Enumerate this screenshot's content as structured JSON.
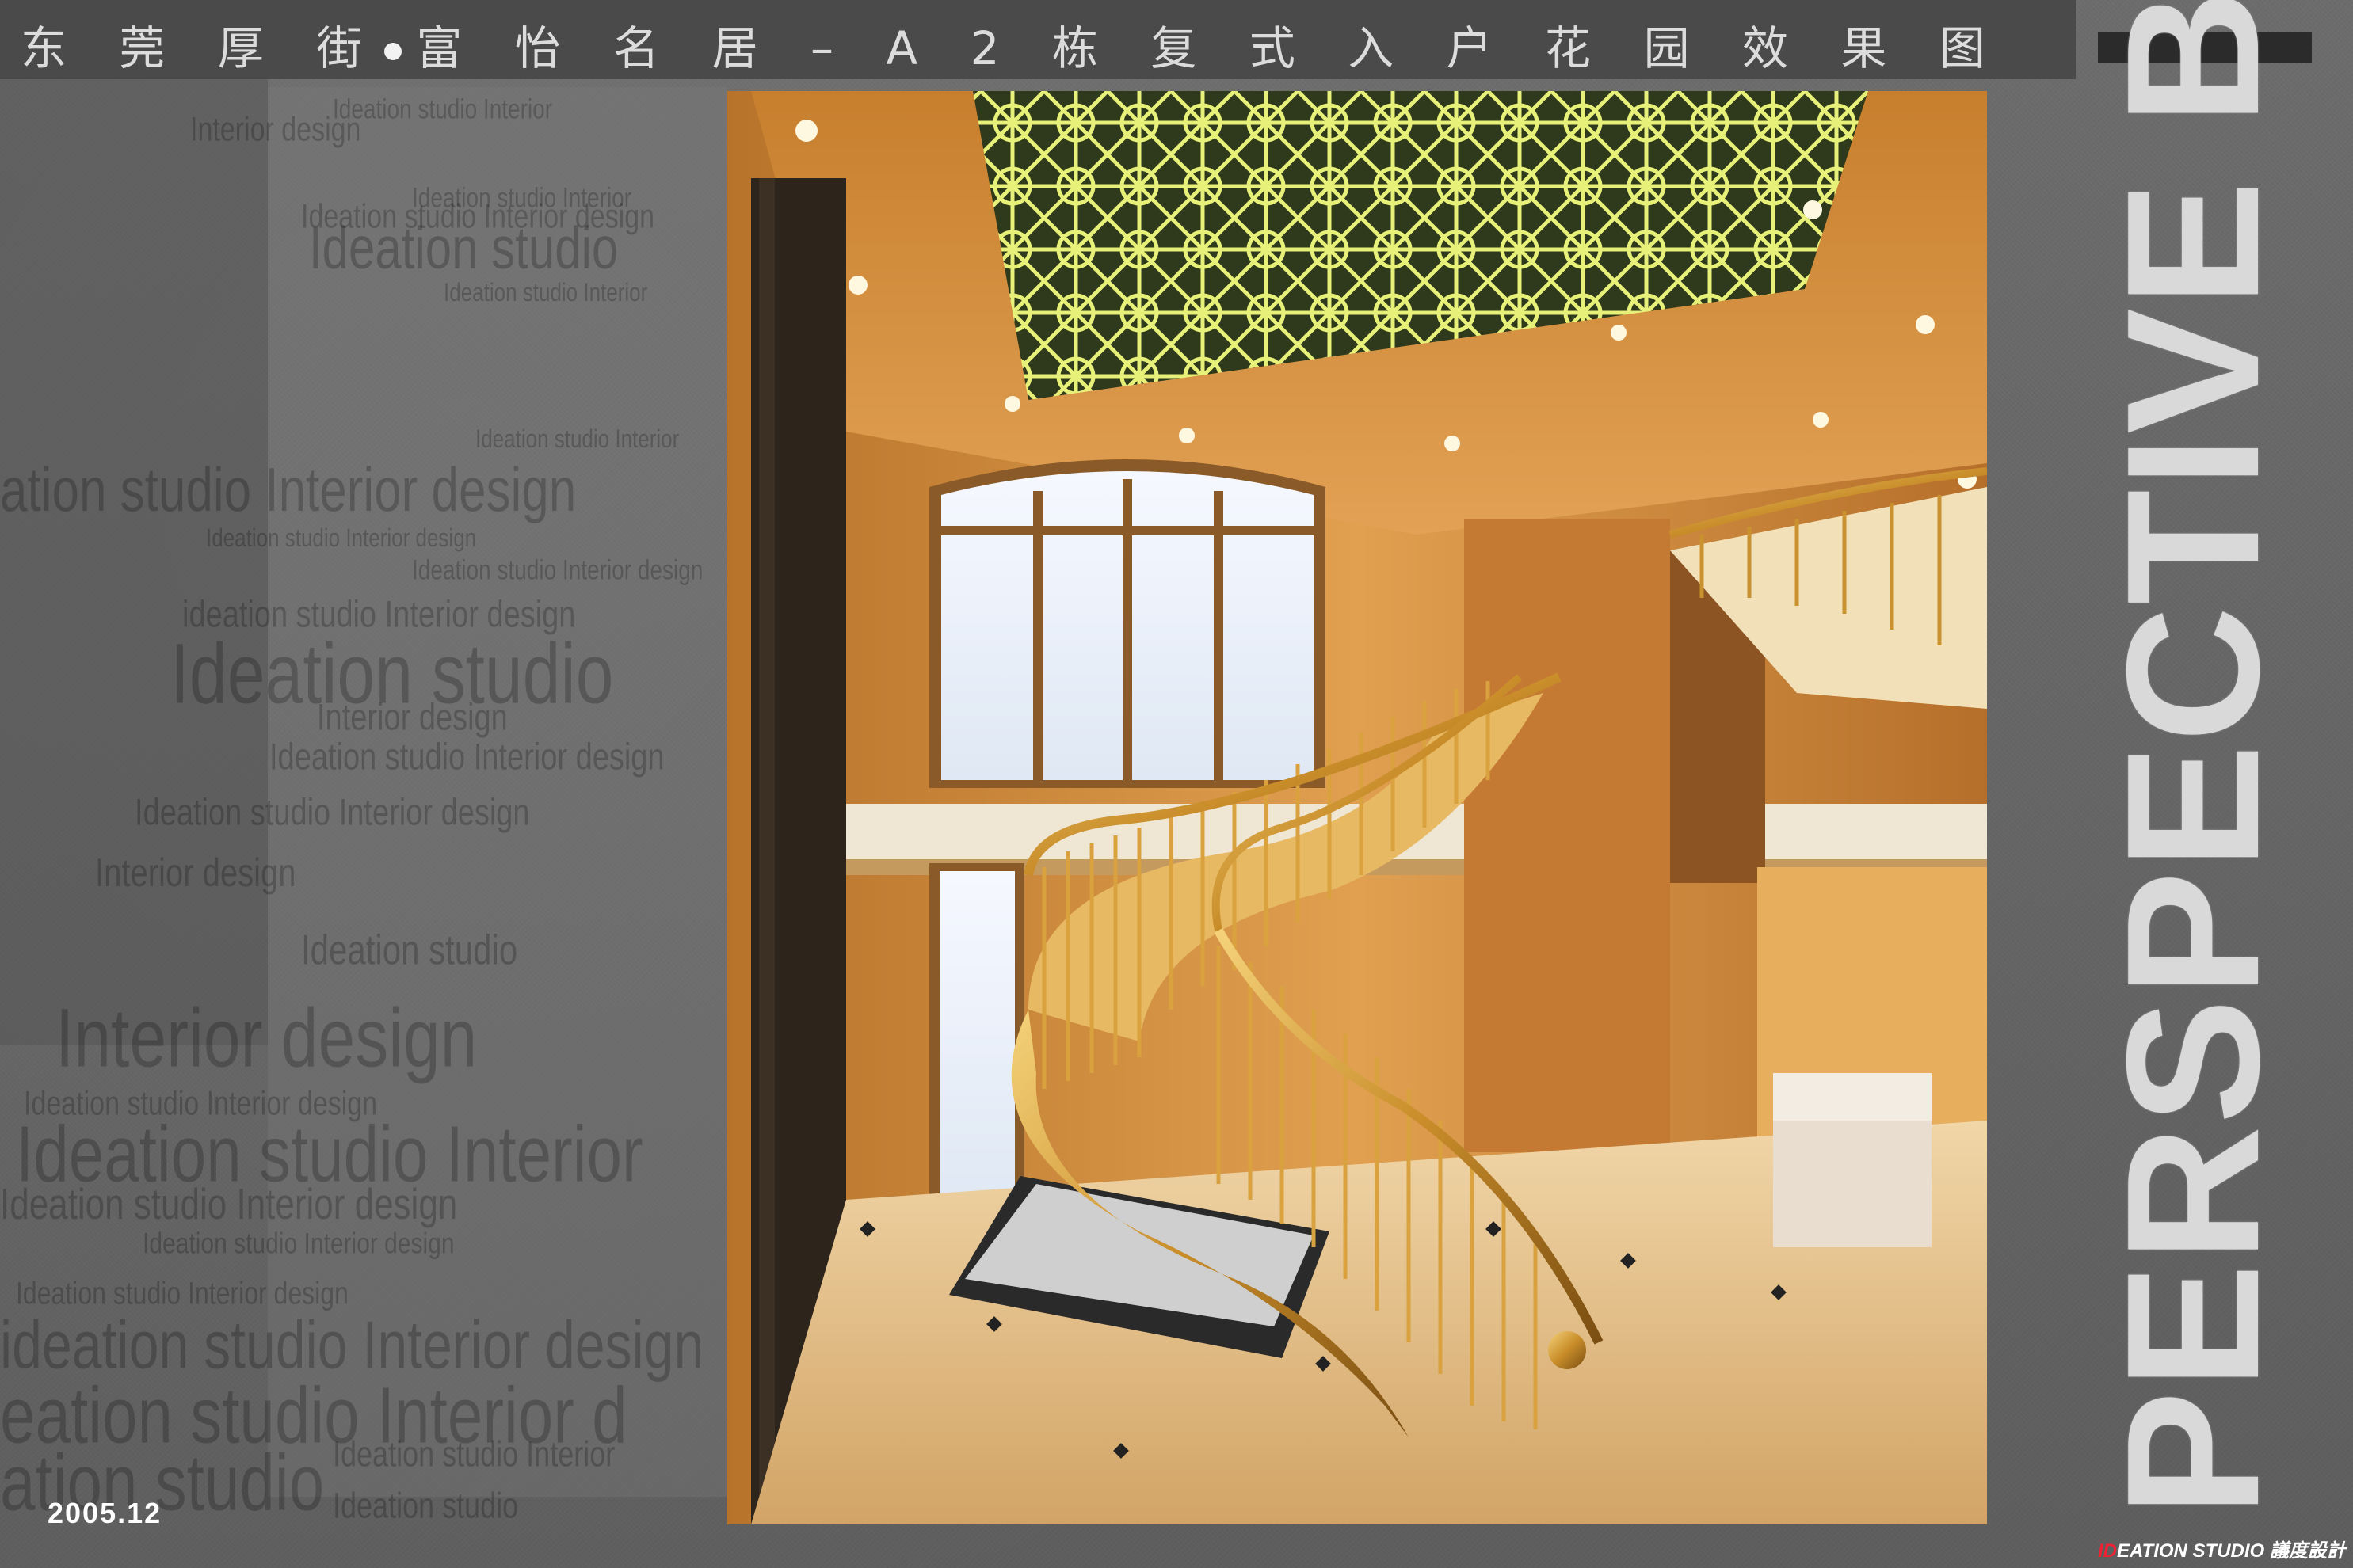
{
  "header": {
    "title_part1": "东 莞 厚 街",
    "title_part2": "富 怡 名 居 – A 2 栋 复 式 入 户 花 园 效 果 图"
  },
  "date": "2005.12",
  "side_title": "PERSPECTIVE BOARD",
  "logo": {
    "mark": "ID",
    "text": "EATION STUDIO 議度設計"
  },
  "watermarks": [
    "Interior design",
    "Ideation studio Interior",
    "Ideation studio Interior",
    "Ideation studio Interior design",
    "Ideation studio",
    "Ideation studio Interior",
    "ation studio Interior design",
    "Ideation studio Interior",
    "Ideation studio Interior design",
    "ideation studio Interior design",
    "Ideation studio Interior design",
    "Ideation studio",
    "Interior design",
    "Ideation studio Interior design",
    "Ideation studio Interior design",
    "Interior design",
    "Ideation studio",
    "Interior design",
    "Ideation studio Interior design",
    "Ideation studio Interior",
    "Ideation studio Interior design",
    "Ideation studio Interior design",
    "Ideation studio Interior design",
    "ideation studio Interior design",
    "eation studio Interior d",
    "Ideation studio Interior",
    "ation studio",
    "Ideation studio"
  ],
  "colors": {
    "background": "#666666",
    "title_bar": "#4a4a4a",
    "title_text": "#dcdcdc",
    "gold": "#c8902c",
    "side_text": "#d9d9d9"
  }
}
